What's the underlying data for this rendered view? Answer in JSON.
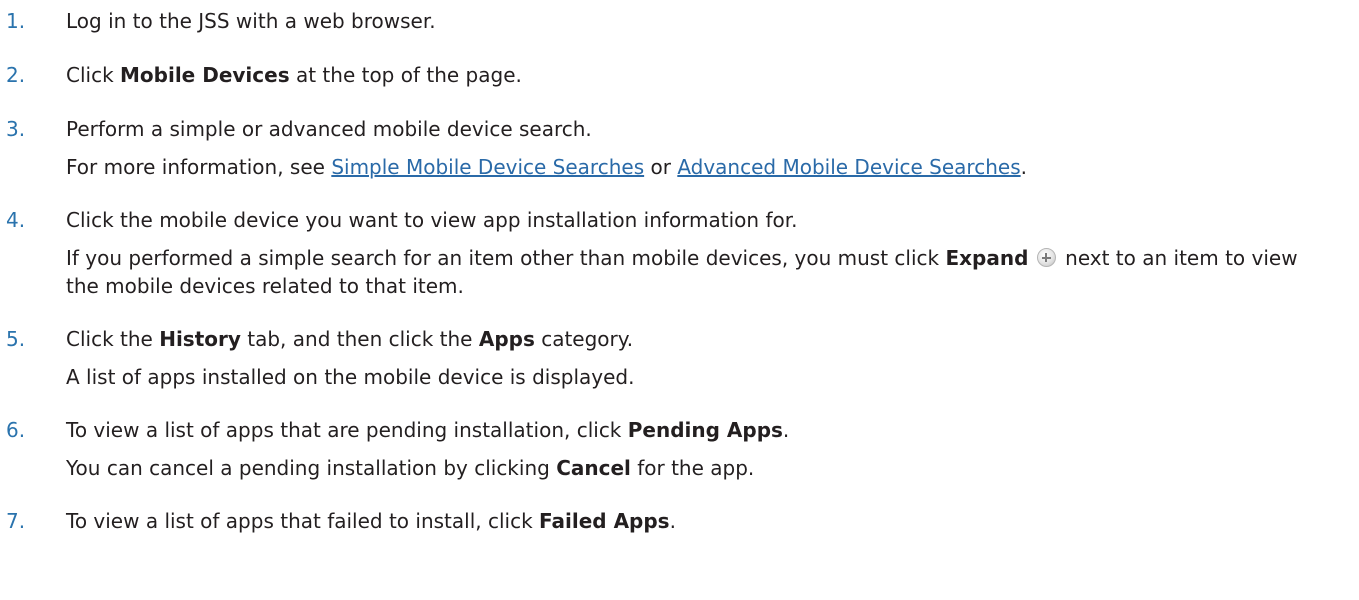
{
  "steps": [
    {
      "number": "1.",
      "text": "Log in to the JSS with a web browser."
    },
    {
      "number": "2.",
      "pre": "Click ",
      "bold": "Mobile Devices",
      "post": " at the top of the page."
    },
    {
      "number": "3.",
      "text": "Perform a simple or advanced mobile device search.",
      "detail": {
        "pre": "For more information, see ",
        "link1": "Simple Mobile Device Searches",
        "mid": " or ",
        "link2": "Advanced Mobile Device Searches",
        "post": "."
      }
    },
    {
      "number": "4.",
      "text": "Click the mobile device you want to view app installation information for.",
      "detail": {
        "pre": "If you performed a simple search for an item other than mobile devices, you must click ",
        "bold": "Expand",
        "icon": "expand-plus-icon",
        "post": " next to an item to view the mobile devices related to that item."
      }
    },
    {
      "number": "5.",
      "pre": "Click the ",
      "bold1": "History",
      "mid": " tab, and then click the ",
      "bold2": "Apps",
      "post": " category.",
      "detail": "A list of apps installed on the mobile device is displayed."
    },
    {
      "number": "6.",
      "pre": "To view a list of apps that are pending installation, click ",
      "bold": "Pending Apps",
      "post": ".",
      "detail": {
        "pre": "You can cancel a pending installation by clicking ",
        "bold": "Cancel",
        "post": " for the app."
      }
    },
    {
      "number": "7.",
      "pre": "To view a list of apps that failed to install, click ",
      "bold": "Failed Apps",
      "post": "."
    }
  ],
  "colors": {
    "step_number": "#2a73ad",
    "link": "#2a6aa8",
    "text": "#231f20"
  }
}
